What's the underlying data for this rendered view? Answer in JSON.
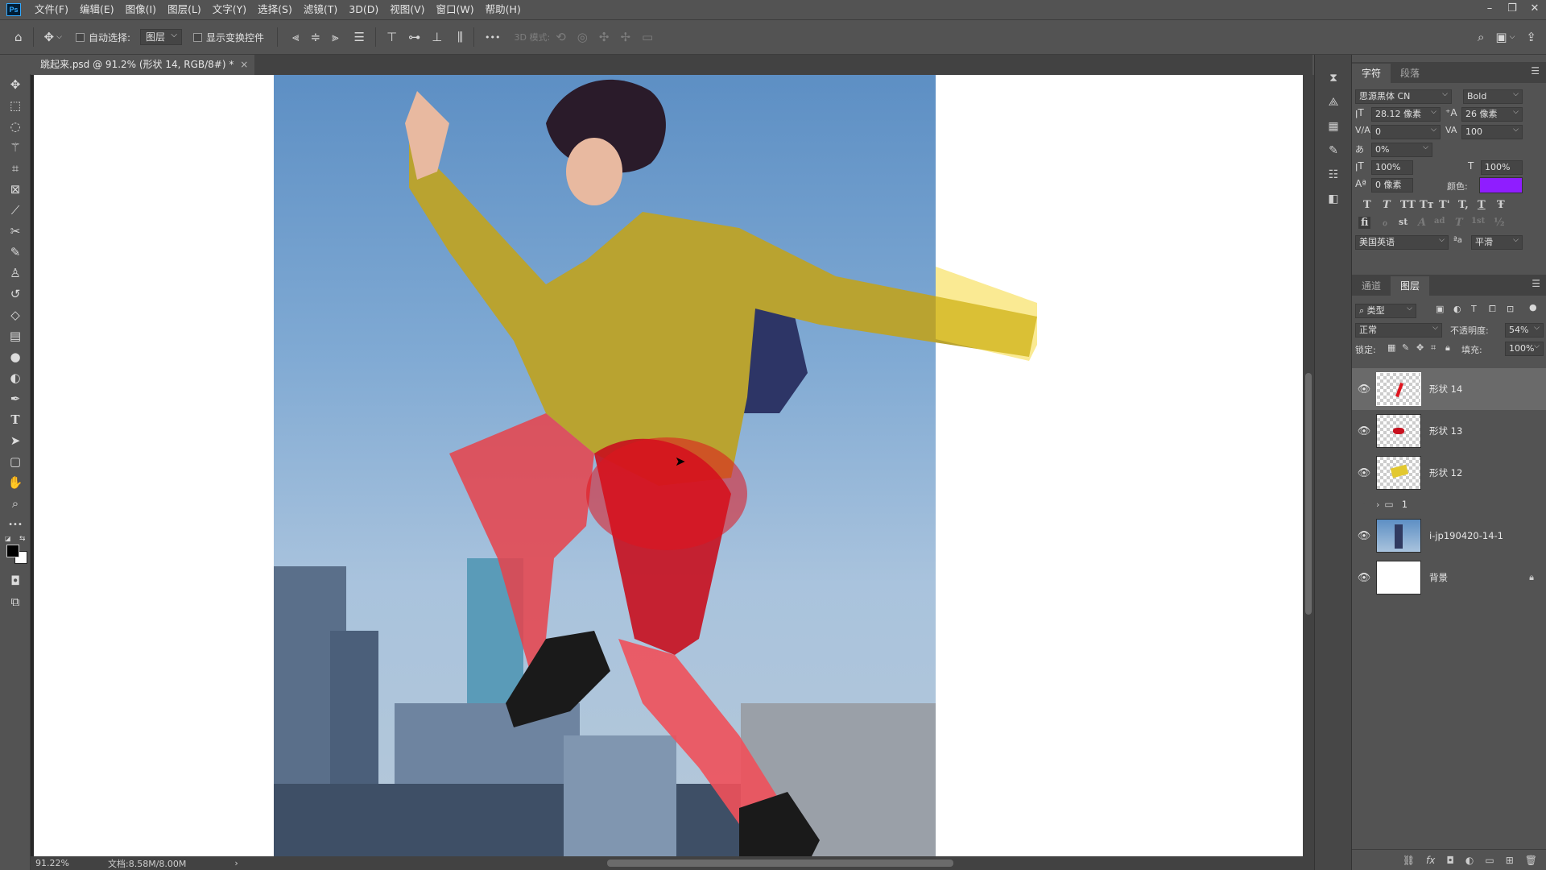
{
  "app": {
    "logo": "Ps"
  },
  "menu": [
    "文件(F)",
    "编辑(E)",
    "图像(I)",
    "图层(L)",
    "文字(Y)",
    "选择(S)",
    "滤镜(T)",
    "3D(D)",
    "视图(V)",
    "窗口(W)",
    "帮助(H)"
  ],
  "window_controls": {
    "minimize": "–",
    "restore": "❐",
    "close": "✕"
  },
  "options": {
    "auto_select_label": "自动选择:",
    "auto_select_target": "图层",
    "show_transform_label": "显示变换控件",
    "mode_3d_label": "3D 模式:",
    "more": "•••"
  },
  "document": {
    "tab_title": "跳起来.psd @ 91.2% (形状 14, RGB/8#) *",
    "close": "×"
  },
  "status": {
    "zoom": "91.22%",
    "doc_size": "文档:8.58M/8.00M",
    "arrow": "›"
  },
  "character_panel": {
    "tabs": [
      "字符",
      "段落"
    ],
    "font_family": "思源黑体 CN",
    "font_style": "Bold",
    "font_size": "28.12 像素",
    "leading": "26 像素",
    "kerning": "0",
    "tracking": "100",
    "tsume": "0%",
    "vertical_scale": "100%",
    "horizontal_scale": "100%",
    "baseline_shift": "0 像素",
    "color_label": "颜色:",
    "color": "#8f1dff",
    "language": "美国英语",
    "aa_label": "ªa",
    "antialias": "平滑",
    "type_styles": [
      "T",
      "T",
      "TT",
      "Tт",
      "T'",
      "T,",
      "T",
      "Ŧ"
    ],
    "opentype": [
      "fi",
      "ℴ",
      "st",
      "A",
      "ad",
      "T",
      "1st",
      "½"
    ]
  },
  "layers_panel": {
    "tabs": [
      "通道",
      "图层"
    ],
    "filter_kind": "类型",
    "blend_mode": "正常",
    "opacity_label": "不透明度:",
    "opacity": "54%",
    "lock_label": "锁定:",
    "fill_label": "填充:",
    "fill": "100%",
    "layers": [
      {
        "name": "形状 14",
        "visible": true,
        "selected": true
      },
      {
        "name": "形状 13",
        "visible": true,
        "selected": false
      },
      {
        "name": "形状 12",
        "visible": true,
        "selected": false
      },
      {
        "name": "1",
        "visible": false,
        "selected": false,
        "group": true
      },
      {
        "name": "i-jp190420-14-1",
        "visible": true,
        "selected": false
      },
      {
        "name": "背景",
        "visible": true,
        "selected": false,
        "locked": true
      }
    ]
  },
  "colors": {
    "accent_red": "#e0141e",
    "accent_yellow": "#f5d83a",
    "text_color_swatch": "#8f1dff"
  }
}
